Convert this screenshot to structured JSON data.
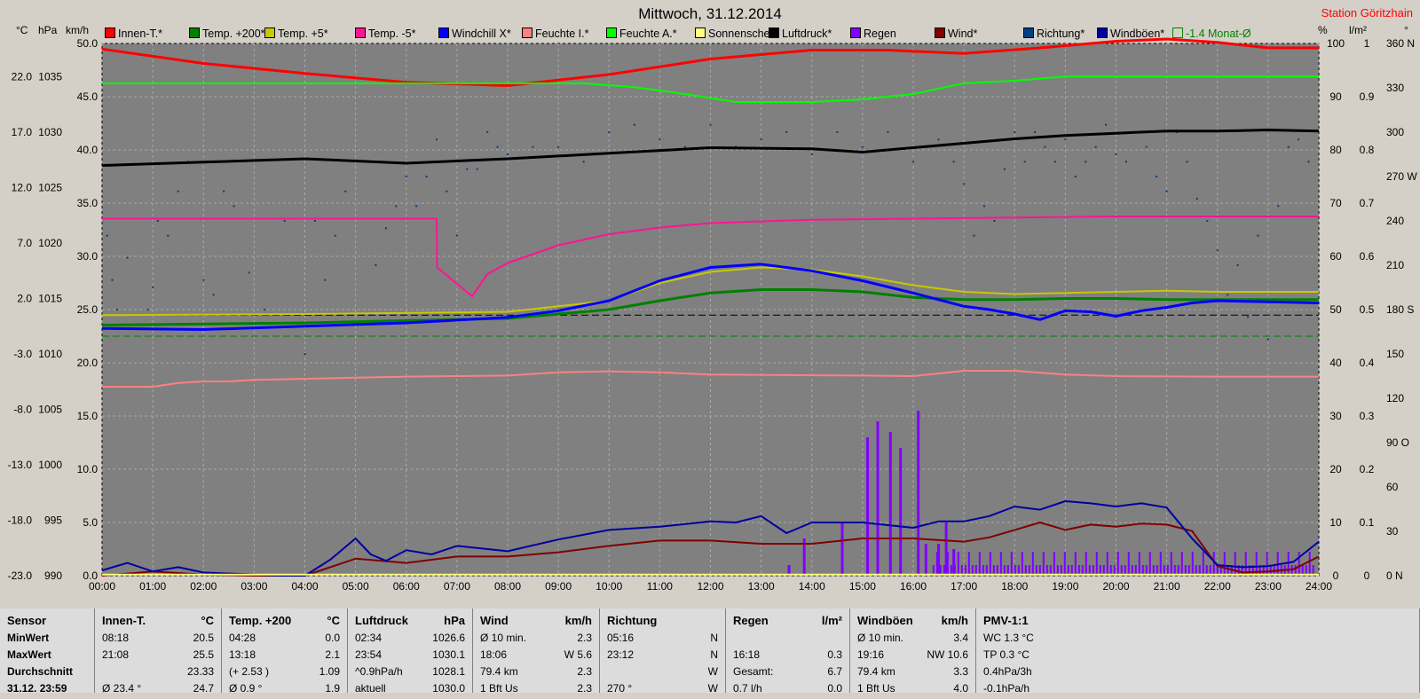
{
  "title": "Mittwoch, 31.12.2014",
  "station": "Station Göritzhain",
  "units": {
    "celsius": "°C",
    "hpa": "hPa",
    "kmh": "km/h",
    "percent": "%",
    "lm2": "l/m²",
    "deg": "°"
  },
  "legend": [
    {
      "label": "Innen-T.*",
      "color": "#ff0000"
    },
    {
      "label": "Temp. +200*",
      "color": "#008000"
    },
    {
      "label": "Temp. +5*",
      "color": "#c8c800"
    },
    {
      "label": "Temp. -5*",
      "color": "#ff1493"
    },
    {
      "label": "Windchill X*",
      "color": "#0000ff"
    },
    {
      "label": "Feuchte I.*",
      "color": "#ff8080"
    },
    {
      "label": "Feuchte A.*",
      "color": "#00ff00"
    },
    {
      "label": "Sonnenschein",
      "color": "#ffff80"
    },
    {
      "label": "Luftdruck*",
      "color": "#000000"
    },
    {
      "label": "Regen",
      "color": "#8000ff"
    },
    {
      "label": "Wind*",
      "color": "#800000"
    },
    {
      "label": "Richtung*",
      "color": "#004080"
    },
    {
      "label": "Windböen*",
      "color": "#0000a0"
    },
    {
      "label": "-1.4 Monat-Ø",
      "color": "#008000"
    }
  ],
  "chart_data": {
    "type": "line",
    "x_ticks": [
      "00:00",
      "01:00",
      "02:00",
      "03:00",
      "04:00",
      "05:00",
      "06:00",
      "07:00",
      "08:00",
      "09:00",
      "10:00",
      "11:00",
      "12:00",
      "13:00",
      "14:00",
      "15:00",
      "16:00",
      "17:00",
      "18:00",
      "19:00",
      "20:00",
      "21:00",
      "22:00",
      "23:00",
      "24:00"
    ],
    "axes": {
      "celsius": {
        "ticks": [
          "22.0",
          "17.0",
          "12.0",
          "7.0",
          "2.0",
          "-3.0",
          "-8.0",
          "-13.0",
          "-18.0",
          "-23.0"
        ],
        "range": [
          -23,
          25
        ]
      },
      "hpa": {
        "ticks": [
          "1035",
          "1030",
          "1025",
          "1020",
          "1015",
          "1010",
          "1005",
          "1000",
          "995",
          "990"
        ],
        "range": [
          990,
          1038
        ]
      },
      "kmh": {
        "ticks": [
          "50.0",
          "45.0",
          "40.0",
          "35.0",
          "30.0",
          "25.0",
          "20.0",
          "15.0",
          "10.0",
          "5.0",
          "0.0"
        ],
        "range": [
          0,
          50
        ]
      },
      "percent": {
        "ticks": [
          "100",
          "90",
          "80",
          "70",
          "60",
          "50",
          "40",
          "30",
          "20",
          "10",
          "0"
        ],
        "range": [
          0,
          100
        ]
      },
      "lm2": {
        "ticks": [
          "1",
          "0.9",
          "0.8",
          "0.7",
          "0.6",
          "0.5",
          "0.4",
          "0.3",
          "0.2",
          "0.1",
          "0"
        ],
        "range": [
          0,
          1
        ]
      },
      "direction": {
        "ticks": [
          "360 N",
          "330",
          "300",
          "270 W",
          "240",
          "210",
          "180 S",
          "150",
          "120",
          "90 O",
          "60",
          "30",
          "0 N"
        ],
        "range": [
          0,
          360
        ]
      }
    },
    "series": [
      {
        "name": "Innen-T.*",
        "axis": "celsius",
        "color": "#ff0000",
        "width": 3,
        "x": [
          0,
          2,
          4,
          6,
          8,
          10,
          12,
          14,
          15.5,
          17,
          18.5,
          20,
          21,
          22,
          23,
          24
        ],
        "y": [
          24.5,
          23.2,
          22.3,
          21.5,
          21.2,
          22.2,
          23.6,
          24.4,
          24.4,
          24.1,
          24.6,
          25.2,
          25.4,
          25.1,
          24.6,
          24.6
        ]
      },
      {
        "name": "Feuchte A.*",
        "axis": "percent",
        "color": "#00ff00",
        "width": 2,
        "x": [
          0,
          4,
          8,
          9.5,
          10.5,
          11.5,
          12.5,
          14,
          15,
          16,
          17,
          18,
          19,
          20,
          21,
          22,
          23,
          24
        ],
        "y": [
          92.5,
          92.5,
          92.5,
          92.5,
          91.8,
          90.5,
          89,
          89,
          89.5,
          90.5,
          92.5,
          93,
          93.8,
          93.8,
          93.8,
          93.8,
          93.8,
          93.8
        ]
      },
      {
        "name": "Luftdruck*",
        "axis": "hpa",
        "color": "#000000",
        "width": 3,
        "x": [
          0,
          2,
          4,
          6,
          8,
          10,
          12,
          14,
          15,
          16,
          17,
          18,
          19,
          20,
          21,
          22,
          23,
          24
        ],
        "y": [
          1027,
          1027.3,
          1027.6,
          1027.2,
          1027.6,
          1028.1,
          1028.6,
          1028.5,
          1028.2,
          1028.6,
          1029,
          1029.4,
          1029.7,
          1029.9,
          1030.1,
          1030.1,
          1030.2,
          1030.1
        ]
      },
      {
        "name": "Temp. -5*",
        "axis": "celsius",
        "color": "#ff1493",
        "width": 2,
        "x": [
          0,
          6.6,
          6.61,
          7.3,
          7.6,
          8,
          9,
          10,
          11,
          12,
          14,
          16,
          18,
          20,
          22,
          24
        ],
        "y": [
          9.2,
          9.2,
          4.8,
          2.2,
          4.2,
          5.2,
          6.8,
          7.8,
          8.4,
          8.8,
          9.1,
          9.2,
          9.3,
          9.4,
          9.4,
          9.4
        ]
      },
      {
        "name": "Temp. +5*",
        "axis": "celsius",
        "color": "#c8c800",
        "width": 2,
        "x": [
          0,
          4,
          8,
          10,
          11,
          12,
          13,
          14,
          15,
          16,
          17,
          18,
          19,
          20,
          21,
          22,
          24
        ],
        "y": [
          0.5,
          0.6,
          0.8,
          1.8,
          3.4,
          4.4,
          4.8,
          4.6,
          4.0,
          3.2,
          2.6,
          2.4,
          2.5,
          2.6,
          2.7,
          2.6,
          2.6
        ]
      },
      {
        "name": "Temp. +200*",
        "axis": "celsius",
        "color": "#008000",
        "width": 3,
        "x": [
          0,
          4,
          8,
          10,
          11,
          12,
          13,
          14,
          15,
          16,
          17,
          18,
          19,
          20,
          21,
          22,
          24
        ],
        "y": [
          -0.4,
          -0.2,
          0.2,
          1.0,
          1.8,
          2.5,
          2.8,
          2.8,
          2.6,
          2.1,
          1.9,
          1.9,
          2.0,
          2.0,
          1.9,
          1.9,
          1.9
        ]
      },
      {
        "name": "Windchill X*",
        "axis": "celsius",
        "color": "#0000ff",
        "width": 3,
        "x": [
          0,
          2,
          4,
          6,
          8,
          9,
          10,
          11,
          12,
          13,
          14,
          15,
          16,
          17,
          17.5,
          18,
          18.5,
          19,
          19.5,
          20,
          20.5,
          21,
          21.5,
          22,
          23,
          24
        ],
        "y": [
          -0.7,
          -0.8,
          -0.5,
          -0.2,
          0.3,
          0.9,
          1.8,
          3.6,
          4.8,
          5.1,
          4.5,
          3.6,
          2.5,
          1.3,
          1.0,
          0.6,
          0.1,
          0.9,
          0.8,
          0.4,
          0.9,
          1.2,
          1.6,
          1.8,
          1.7,
          1.6
        ]
      },
      {
        "name": "Feuchte I.*",
        "axis": "percent",
        "color": "#ff8080",
        "width": 2,
        "x": [
          0,
          1,
          1.5,
          2,
          2.5,
          3,
          4,
          5,
          6,
          7,
          8,
          9,
          10,
          11,
          12,
          15,
          16,
          17,
          18,
          19,
          20,
          22,
          24
        ],
        "y": [
          35.5,
          35.5,
          36.2,
          36.5,
          36.5,
          36.8,
          37,
          37.2,
          37.4,
          37.5,
          37.6,
          38.2,
          38.4,
          38.2,
          37.8,
          37.6,
          37.5,
          38.5,
          38.5,
          37.8,
          37.5,
          37.4,
          37.4
        ]
      },
      {
        "name": "Wind*",
        "axis": "kmh",
        "color": "#800000",
        "width": 2,
        "x": [
          0,
          1,
          2,
          3,
          4,
          5,
          6,
          7,
          8,
          9,
          10,
          11,
          12,
          13,
          14,
          15,
          16,
          17,
          17.5,
          18,
          18.5,
          19,
          19.5,
          20,
          20.5,
          21,
          21.5,
          22,
          22.5,
          23,
          23.5,
          24
        ],
        "y": [
          0,
          0.4,
          0.1,
          0,
          0,
          1.6,
          1.2,
          1.8,
          1.8,
          2.2,
          2.8,
          3.3,
          3.3,
          3.0,
          3.0,
          3.5,
          3.5,
          3.2,
          3.6,
          4.3,
          5.0,
          4.3,
          4.8,
          4.6,
          4.9,
          4.8,
          4.2,
          0.9,
          0.3,
          0.4,
          0.6,
          1.8
        ]
      },
      {
        "name": "Windböen*",
        "axis": "kmh",
        "color": "#0000a0",
        "width": 2,
        "x": [
          0,
          0.5,
          1,
          1.5,
          2,
          3,
          3.5,
          4,
          4.5,
          5,
          5.3,
          5.6,
          6,
          6.5,
          7,
          8,
          9,
          10,
          11,
          12,
          12.5,
          13,
          13.5,
          14,
          15,
          16,
          16.5,
          17,
          17.5,
          18,
          18.5,
          19,
          19.5,
          20,
          20.5,
          21,
          21.5,
          22,
          22.5,
          23,
          23.5,
          24
        ],
        "y": [
          0.5,
          1.2,
          0.4,
          0.8,
          0.3,
          0.1,
          0,
          0,
          1.5,
          3.5,
          2.0,
          1.4,
          2.4,
          2.0,
          2.8,
          2.3,
          3.4,
          4.3,
          4.6,
          5.1,
          5.0,
          5.6,
          4.0,
          5.0,
          5.0,
          4.5,
          5.1,
          5.1,
          5.6,
          6.5,
          6.2,
          7.0,
          6.8,
          6.5,
          6.8,
          6.4,
          3.5,
          1.0,
          0.8,
          0.9,
          1.3,
          3.2
        ]
      },
      {
        "name": "Sonnenschein",
        "axis": "kmh",
        "color": "#ffff80",
        "width": 2,
        "x": [
          0,
          24
        ],
        "y": [
          0.1,
          0.1
        ]
      }
    ],
    "reference_lines": [
      {
        "axis": "celsius",
        "value": 0.5,
        "color": "#000000",
        "dash": "8,4"
      },
      {
        "axis": "celsius",
        "value": -1.4,
        "color": "#008000",
        "dash": "8,4"
      }
    ],
    "rain_bars": {
      "axis": "lm2",
      "color": "#8000ff",
      "x": [
        13.55,
        13.85,
        14.6,
        15.1,
        15.3,
        15.55,
        15.75,
        16.1,
        16.25,
        16.5,
        16.65,
        16.8
      ],
      "y": [
        0.02,
        0.07,
        0.1,
        0.26,
        0.29,
        0.27,
        0.24,
        0.31,
        0.06,
        0.06,
        0.1,
        0.05
      ],
      "dense_from": 16.4,
      "dense_to": 23.9,
      "dense_low": 0.02,
      "dense_high": 0.045
    },
    "direction_scatter": {
      "axis": "direction",
      "color": "#004080",
      "x": [
        0.1,
        0.2,
        0.3,
        0.5,
        0.7,
        0.9,
        1.0,
        1.1,
        1.3,
        1.5,
        1.7,
        2.0,
        2.2,
        2.4,
        2.6,
        2.9,
        3.2,
        3.6,
        4.0,
        4.2,
        4.4,
        4.6,
        4.8,
        5.0,
        5.2,
        5.4,
        5.6,
        5.8,
        6.0,
        6.2,
        6.4,
        6.6,
        6.8,
        7.0,
        7.2,
        7.4,
        7.6,
        7.8,
        8.0,
        8.5,
        9.0,
        9.5,
        10.0,
        10.5,
        11.0,
        11.5,
        12.0,
        12.5,
        13.0,
        13.5,
        14.0,
        14.5,
        15.0,
        15.5,
        16.0,
        16.5,
        16.8,
        17.0,
        17.2,
        17.4,
        17.6,
        17.8,
        18.0,
        18.2,
        18.4,
        18.6,
        18.8,
        19.0,
        19.2,
        19.4,
        19.6,
        19.8,
        20.0,
        20.2,
        20.4,
        20.6,
        20.8,
        21.0,
        21.2,
        21.4,
        21.6,
        21.8,
        22.0,
        22.2,
        22.4,
        22.6,
        22.8,
        23.0,
        23.2,
        23.4,
        23.6,
        23.8
      ],
      "y": [
        230,
        200,
        180,
        215,
        170,
        180,
        195,
        240,
        230,
        260,
        280,
        200,
        190,
        260,
        250,
        205,
        180,
        240,
        150,
        240,
        200,
        230,
        260,
        170,
        280,
        210,
        235,
        250,
        270,
        250,
        270,
        295,
        260,
        230,
        275,
        275,
        300,
        290,
        285,
        290,
        290,
        280,
        300,
        305,
        295,
        290,
        305,
        290,
        295,
        300,
        285,
        300,
        290,
        300,
        280,
        295,
        280,
        265,
        230,
        250,
        240,
        275,
        300,
        280,
        300,
        290,
        280,
        295,
        270,
        280,
        290,
        305,
        285,
        280,
        300,
        290,
        270,
        260,
        300,
        280,
        255,
        240,
        220,
        190,
        210,
        175,
        230,
        160,
        250,
        290,
        295,
        280
      ]
    }
  },
  "table": [
    {
      "header": [
        "Sensor",
        ""
      ],
      "rows": [
        [
          "MinWert",
          ""
        ],
        [
          "MaxWert",
          ""
        ],
        [
          "Durchschnitt",
          ""
        ],
        [
          "31.12. 23:59",
          ""
        ]
      ]
    },
    {
      "header": [
        "Innen-T.",
        "°C"
      ],
      "rows": [
        [
          "08:18",
          "20.5"
        ],
        [
          "21:08",
          "25.5"
        ],
        [
          "",
          "23.33"
        ],
        [
          "Ø 23.4 °",
          "24.7"
        ]
      ]
    },
    {
      "header": [
        "Temp. +200",
        "°C"
      ],
      "rows": [
        [
          "04:28",
          "0.0"
        ],
        [
          "13:18",
          "2.1"
        ],
        [
          "(+ 2.53 )",
          "1.09"
        ],
        [
          "Ø 0.9 °",
          "1.9"
        ]
      ]
    },
    {
      "header": [
        "Luftdruck",
        "hPa"
      ],
      "rows": [
        [
          "02:34",
          "1026.6"
        ],
        [
          "23:54",
          "1030.1"
        ],
        [
          "^0.9hPa/h",
          "1028.1"
        ],
        [
          "aktuell",
          "1030.0"
        ]
      ]
    },
    {
      "header": [
        "Wind",
        "km/h"
      ],
      "rows": [
        [
          "Ø 10 min.",
          "2.3"
        ],
        [
          "18:06",
          "W 5.6"
        ],
        [
          "79.4 km",
          "2.3"
        ],
        [
          "1 Bft Us",
          "2.3"
        ]
      ]
    },
    {
      "header": [
        "Richtung",
        ""
      ],
      "rows": [
        [
          "05:16",
          "N"
        ],
        [
          "23:12",
          "N"
        ],
        [
          "",
          "W"
        ],
        [
          "270 °",
          "W"
        ]
      ]
    },
    {
      "header": [
        "Regen",
        "l/m²"
      ],
      "rows": [
        [
          "",
          ""
        ],
        [
          "16:18",
          "0.3"
        ],
        [
          "Gesamt:",
          "6.7"
        ],
        [
          "0.7 l/h",
          "0.0"
        ]
      ]
    },
    {
      "header": [
        "Windböen",
        "km/h"
      ],
      "rows": [
        [
          "Ø 10 min.",
          "3.4"
        ],
        [
          "19:16",
          "NW 10.6"
        ],
        [
          "79.4 km",
          "3.3"
        ],
        [
          "1 Bft Us",
          "4.0"
        ]
      ]
    },
    {
      "header": [
        "PMV-1:1",
        ""
      ],
      "rows": [
        [
          "WC 1.3 °C",
          ""
        ],
        [
          "TP 0.3 °C",
          ""
        ],
        [
          "0.4hPa/3h",
          ""
        ],
        [
          "-0.1hPa/h",
          ""
        ]
      ]
    }
  ]
}
